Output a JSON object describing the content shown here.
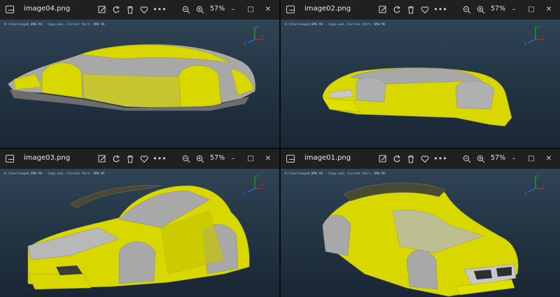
{
  "windows": [
    {
      "filename": "image04.png",
      "zoom": "57%",
      "status": "D:\\Challenge6_BMW M6 - Copy.asm,  Current Part: BMW M6"
    },
    {
      "filename": "image02.png",
      "zoom": "57%",
      "status": "D:\\Challenge6_BMW M6 - Copy.asm,  Current Part: BMW M6"
    },
    {
      "filename": "image03.png",
      "zoom": "57%",
      "status": "D:\\Challenge6_BMW M6 - Copy.asm,  Current Part: BMW M6"
    },
    {
      "filename": "image01.png",
      "zoom": "57%",
      "status": "D:\\Challenge6_BMW M6 - Copy.asm,  Current Part: BMW M6"
    }
  ],
  "toolbar": {
    "more_label": "•••"
  },
  "window_buttons": {
    "minimize": "–",
    "maximize": "□",
    "close": "✕"
  },
  "axis_labels": {
    "x": "X",
    "y": "Y",
    "z": "Z"
  },
  "icons": [
    "image-app-icon",
    "edit-icon",
    "rotate-icon",
    "delete-icon",
    "favorite-icon",
    "more-icon",
    "zoom-out-icon",
    "zoom-in-icon"
  ],
  "colors": {
    "body_yellow": "#d9d900",
    "body_gray": "#a7a7a7",
    "viewport_top": "#2f4455",
    "viewport_bottom": "#1a2634"
  }
}
